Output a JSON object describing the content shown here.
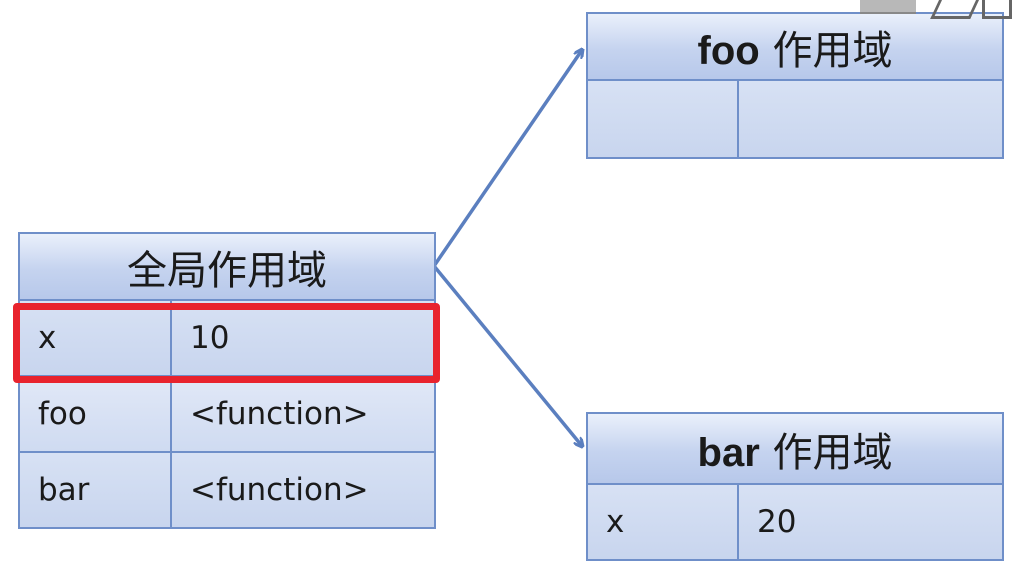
{
  "global_scope": {
    "title": "全局作用域",
    "rows": [
      {
        "name": "x",
        "value": "10"
      },
      {
        "name": "foo",
        "value": "<function>"
      },
      {
        "name": "bar",
        "value": "<function>"
      }
    ]
  },
  "foo_scope": {
    "title_name": "foo",
    "title_suffix": "作用域",
    "rows": [
      {
        "name": "",
        "value": ""
      }
    ]
  },
  "bar_scope": {
    "title_name": "bar",
    "title_suffix": "作用域",
    "rows": [
      {
        "name": "x",
        "value": "20"
      }
    ]
  },
  "colors": {
    "table_border": "#6f8fc9",
    "arrow": "#5b7fbf",
    "highlight": "#e8232d"
  }
}
